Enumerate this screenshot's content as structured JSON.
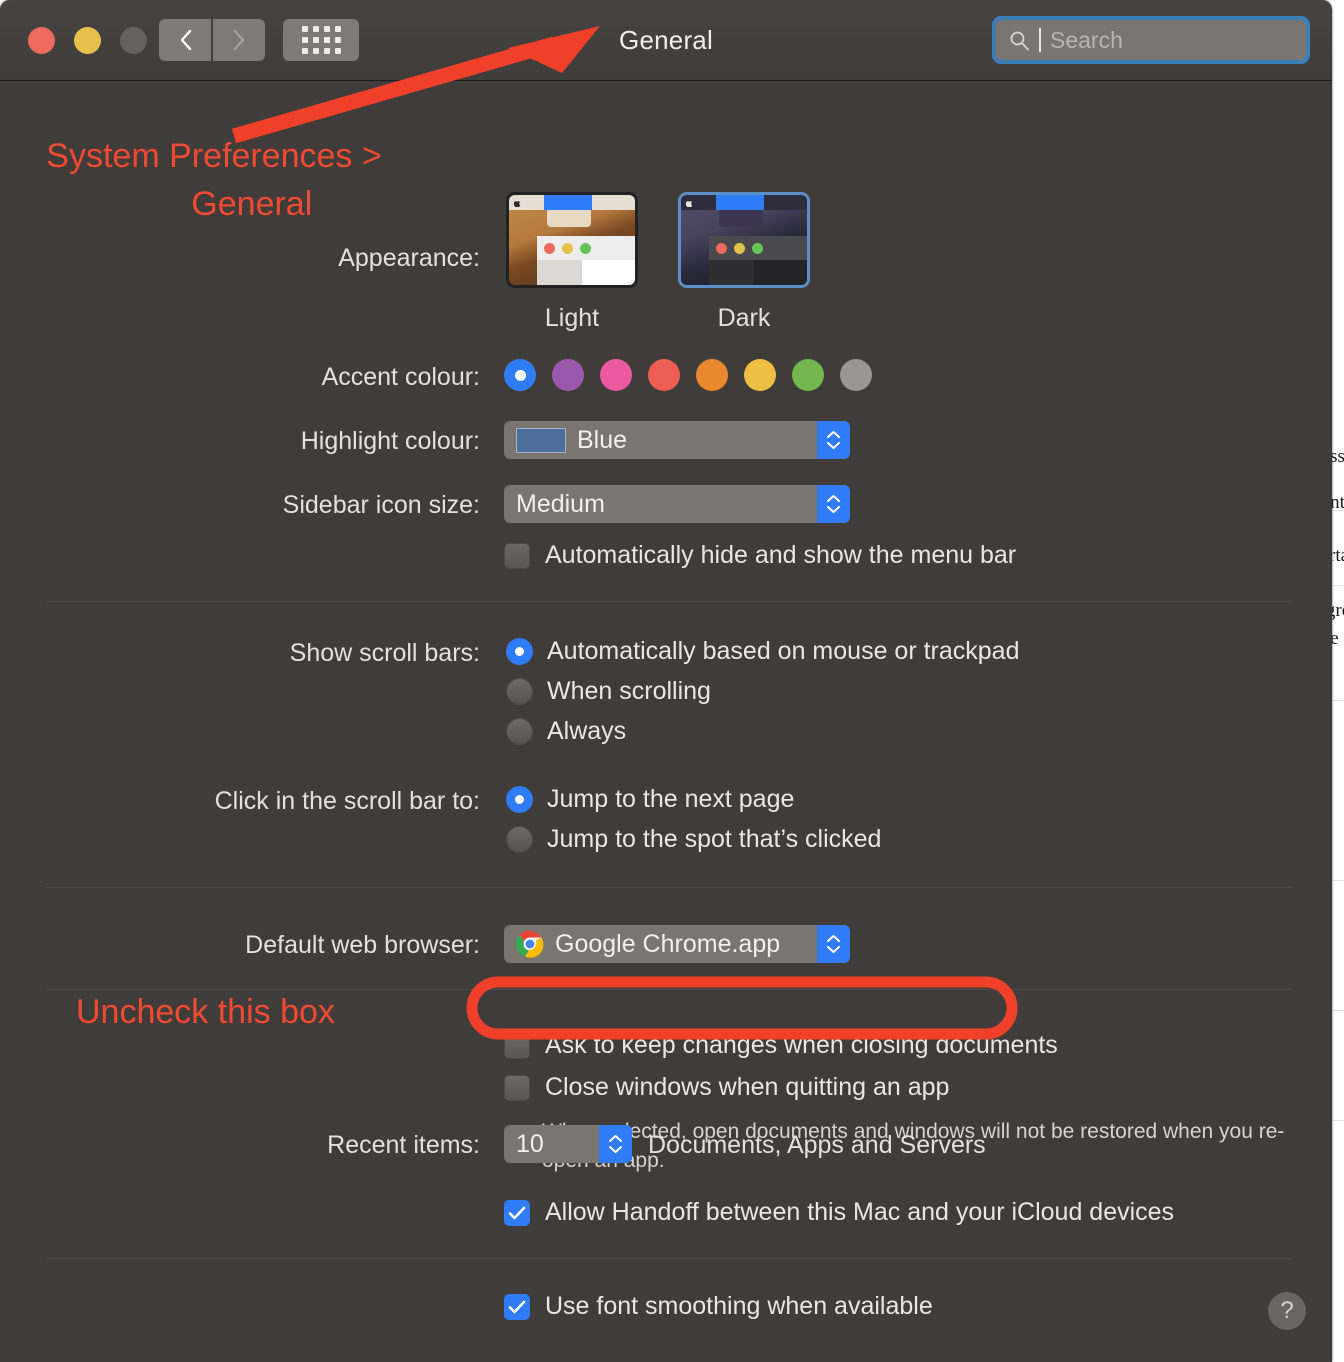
{
  "window": {
    "title": "General",
    "search": {
      "placeholder": "Search",
      "icon": "search-icon"
    },
    "traffic_lights": [
      "close",
      "minimize",
      "zoom"
    ],
    "nav": {
      "back": "back-icon",
      "forward": "forward-icon",
      "grid": "show-all-icon"
    }
  },
  "appearance": {
    "label": "Appearance:",
    "options": [
      {
        "name": "Light",
        "selected": false
      },
      {
        "name": "Dark",
        "selected": true
      }
    ]
  },
  "accent": {
    "label": "Accent colour:",
    "swatches": [
      {
        "name": "blue",
        "hex": "#2f7cf6",
        "selected": true
      },
      {
        "name": "purple",
        "hex": "#9a58ac",
        "selected": false
      },
      {
        "name": "pink",
        "hex": "#eb5aa0",
        "selected": false
      },
      {
        "name": "red",
        "hex": "#ec5d54",
        "selected": false
      },
      {
        "name": "orange",
        "hex": "#e8892f",
        "selected": false
      },
      {
        "name": "yellow",
        "hex": "#edbf45",
        "selected": false
      },
      {
        "name": "green",
        "hex": "#74b74e",
        "selected": false
      },
      {
        "name": "graphite",
        "hex": "#9a9793",
        "selected": false
      }
    ]
  },
  "highlight": {
    "label": "Highlight colour:",
    "value": "Blue",
    "swatch_hex": "#4f6e99"
  },
  "sidebar_icon_size": {
    "label": "Sidebar icon size:",
    "value": "Medium"
  },
  "menu_bar_checkbox": {
    "label": "Automatically hide and show the menu bar",
    "checked": false
  },
  "scroll_bars": {
    "label": "Show scroll bars:",
    "options": [
      {
        "label": "Automatically based on mouse or trackpad",
        "selected": true
      },
      {
        "label": "When scrolling",
        "selected": false
      },
      {
        "label": "Always",
        "selected": false
      }
    ]
  },
  "click_scroll_bar": {
    "label": "Click in the scroll bar to:",
    "options": [
      {
        "label": "Jump to the next page",
        "selected": true
      },
      {
        "label": "Jump to the spot that’s clicked",
        "selected": false
      }
    ]
  },
  "default_browser": {
    "label": "Default web browser:",
    "value": "Google Chrome.app",
    "icon": "chrome-icon"
  },
  "documents": {
    "ask_keep_changes": {
      "label": "Ask to keep changes when closing documents",
      "checked": false
    },
    "close_windows": {
      "label": "Close windows when quitting an app",
      "checked": false
    },
    "close_windows_note": "When selected, open documents and windows will not be restored\nwhen you re-open an app."
  },
  "recent_items": {
    "label": "Recent items:",
    "value": "10",
    "suffix": "Documents, Apps and Servers"
  },
  "handoff": {
    "label": "Allow Handoff between this Mac and your iCloud devices",
    "checked": true
  },
  "font_smoothing": {
    "label": "Use font smoothing when available",
    "checked": true
  },
  "help": {
    "label": "?"
  },
  "annotations": {
    "color": "#f04a32",
    "title_note": "System Preferences >\n        General",
    "checkbox_note": "Uncheck this box"
  },
  "background_document": {
    "fragments": [
      "o",
      "t",
      "t",
      "o",
      "e",
      "r",
      "-",
      "s",
      "S"
    ]
  }
}
